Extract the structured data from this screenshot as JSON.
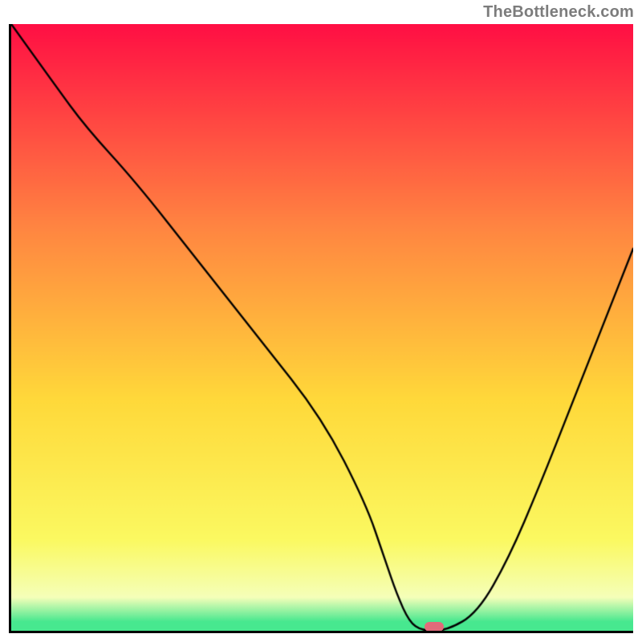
{
  "attribution": "TheBottleneck.com",
  "chart_data": {
    "type": "line",
    "title": "",
    "xlabel": "",
    "ylabel": "",
    "xlim": [
      0,
      100
    ],
    "ylim": [
      0,
      100
    ],
    "x": [
      0,
      7,
      12,
      20,
      30,
      40,
      50,
      57,
      60,
      62,
      64,
      66,
      70,
      75,
      80,
      85,
      90,
      95,
      100
    ],
    "values": [
      100,
      90,
      83,
      74,
      61,
      48,
      35,
      21,
      12,
      6,
      1.5,
      0,
      0,
      3,
      12,
      24,
      37,
      50,
      63
    ],
    "marker": {
      "x": 68,
      "y": 0.6,
      "color": "#e26a7a"
    },
    "gradient_colors": {
      "top": "#ff0f44",
      "mid1": "#ff8741",
      "mid2": "#ffd93a",
      "mid3": "#fbf961",
      "band": "#f5ffb9",
      "bottom": "#47e88f"
    }
  }
}
